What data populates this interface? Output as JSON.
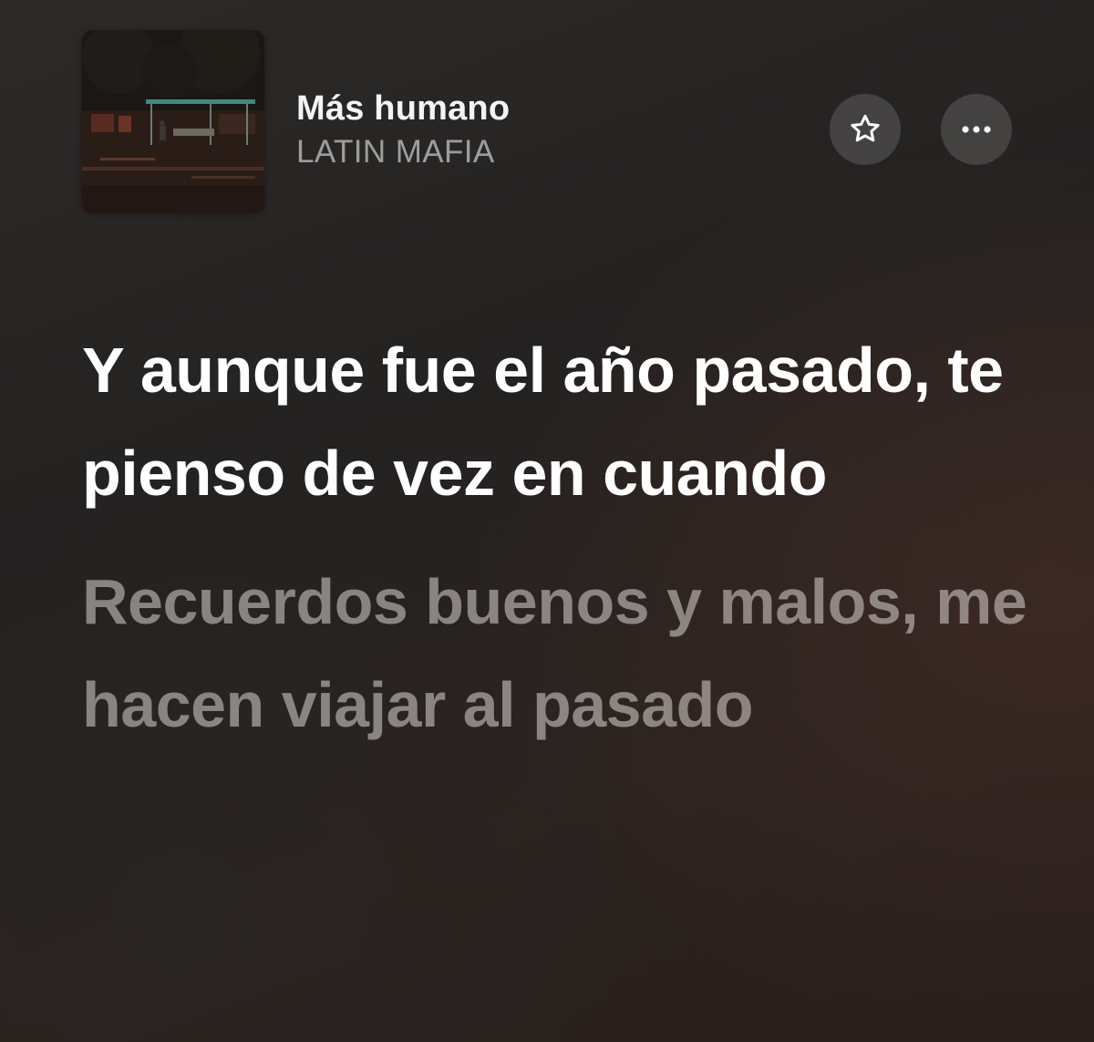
{
  "now_playing": {
    "title": "Más humano",
    "artist": "LATIN MAFIA",
    "artwork_icon": "album-artwork-night-bus-stop"
  },
  "actions": {
    "favorite_icon": "star-icon",
    "more_icon": "ellipsis-icon"
  },
  "lyrics": {
    "current_line": "Y aunque fue el año pasado, te pienso de vez en cuando",
    "next_line": "Recuerdos buenos y malos, me hacen viajar al pasado"
  },
  "colors": {
    "background": "#262322",
    "current_lyric": "#ffffff",
    "upcoming_lyric": "#8a8684",
    "button_bg": "#3b3837"
  }
}
